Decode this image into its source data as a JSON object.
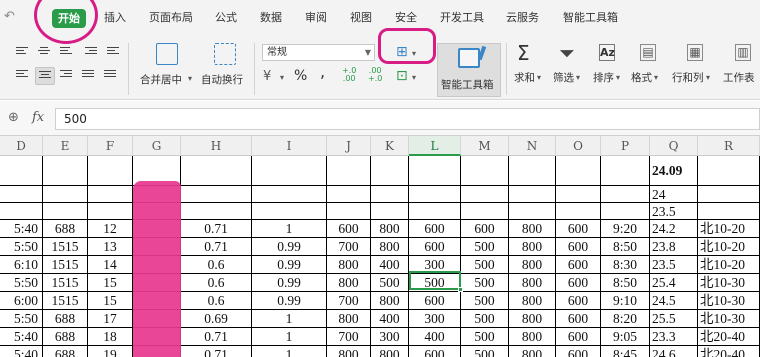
{
  "menu": {
    "tabs": [
      "开始",
      "插入",
      "页面布局",
      "公式",
      "数据",
      "审阅",
      "视图",
      "安全",
      "开发工具",
      "云服务",
      "智能工具箱"
    ],
    "active_tab": "开始"
  },
  "ribbon": {
    "font_name": "常规",
    "merge_center": "合并居中",
    "wrap_text": "自动换行",
    "smart_toolbox": "智能工具箱",
    "sum": "求和",
    "filter": "筛选",
    "sort": "排序",
    "format": "格式",
    "rows_cols": "行和列",
    "worksheet": "工作表",
    "percent": "%",
    "thousands": ",",
    "dec_increase": "+.0\n.00",
    "dec_decrease": ".00\n+.0"
  },
  "formula_bar": {
    "fx_label": "fx",
    "value": "500"
  },
  "sheet": {
    "columns": [
      "D",
      "E",
      "F",
      "G",
      "H",
      "I",
      "J",
      "K",
      "L",
      "M",
      "N",
      "O",
      "P",
      "Q",
      "R"
    ],
    "active_column": "L",
    "q_header_values": [
      "24.09",
      "24",
      "23.5"
    ],
    "rows": [
      [
        "5:40",
        "688",
        "12",
        "",
        "0.71",
        "1",
        "600",
        "800",
        "600",
        "600",
        "800",
        "600",
        "9:20",
        "24.2",
        "北10-20"
      ],
      [
        "5:50",
        "1515",
        "13",
        "",
        "0.71",
        "0.99",
        "700",
        "800",
        "600",
        "500",
        "800",
        "600",
        "8:50",
        "23.8",
        "北10-20"
      ],
      [
        "6:10",
        "1515",
        "14",
        "",
        "0.6",
        "0.99",
        "800",
        "400",
        "300",
        "500",
        "800",
        "600",
        "8:30",
        "23.5",
        "北10-20"
      ],
      [
        "5:50",
        "1515",
        "15",
        "",
        "0.6",
        "0.99",
        "800",
        "500",
        "500",
        "500",
        "800",
        "600",
        "8:50",
        "25.4",
        "北10-30"
      ],
      [
        "6:00",
        "1515",
        "15",
        "",
        "0.6",
        "0.99",
        "700",
        "800",
        "600",
        "500",
        "800",
        "600",
        "9:10",
        "24.5",
        "北10-30"
      ],
      [
        "5:50",
        "688",
        "17",
        "",
        "0.69",
        "1",
        "800",
        "400",
        "300",
        "500",
        "800",
        "600",
        "8:20",
        "25.5",
        "北10-30"
      ],
      [
        "5:40",
        "688",
        "18",
        "",
        "0.71",
        "1",
        "700",
        "300",
        "400",
        "500",
        "800",
        "600",
        "9:05",
        "23.3",
        "北20-40"
      ],
      [
        "5:40",
        "688",
        "19",
        "",
        "0.71",
        "1",
        "800",
        "800",
        "600",
        "500",
        "800",
        "600",
        "8:45",
        "24.6",
        "北20-40"
      ]
    ]
  },
  "colors": {
    "accent": "#2a9c49",
    "annotation": "#d81c86",
    "redaction": "#e8388f"
  }
}
